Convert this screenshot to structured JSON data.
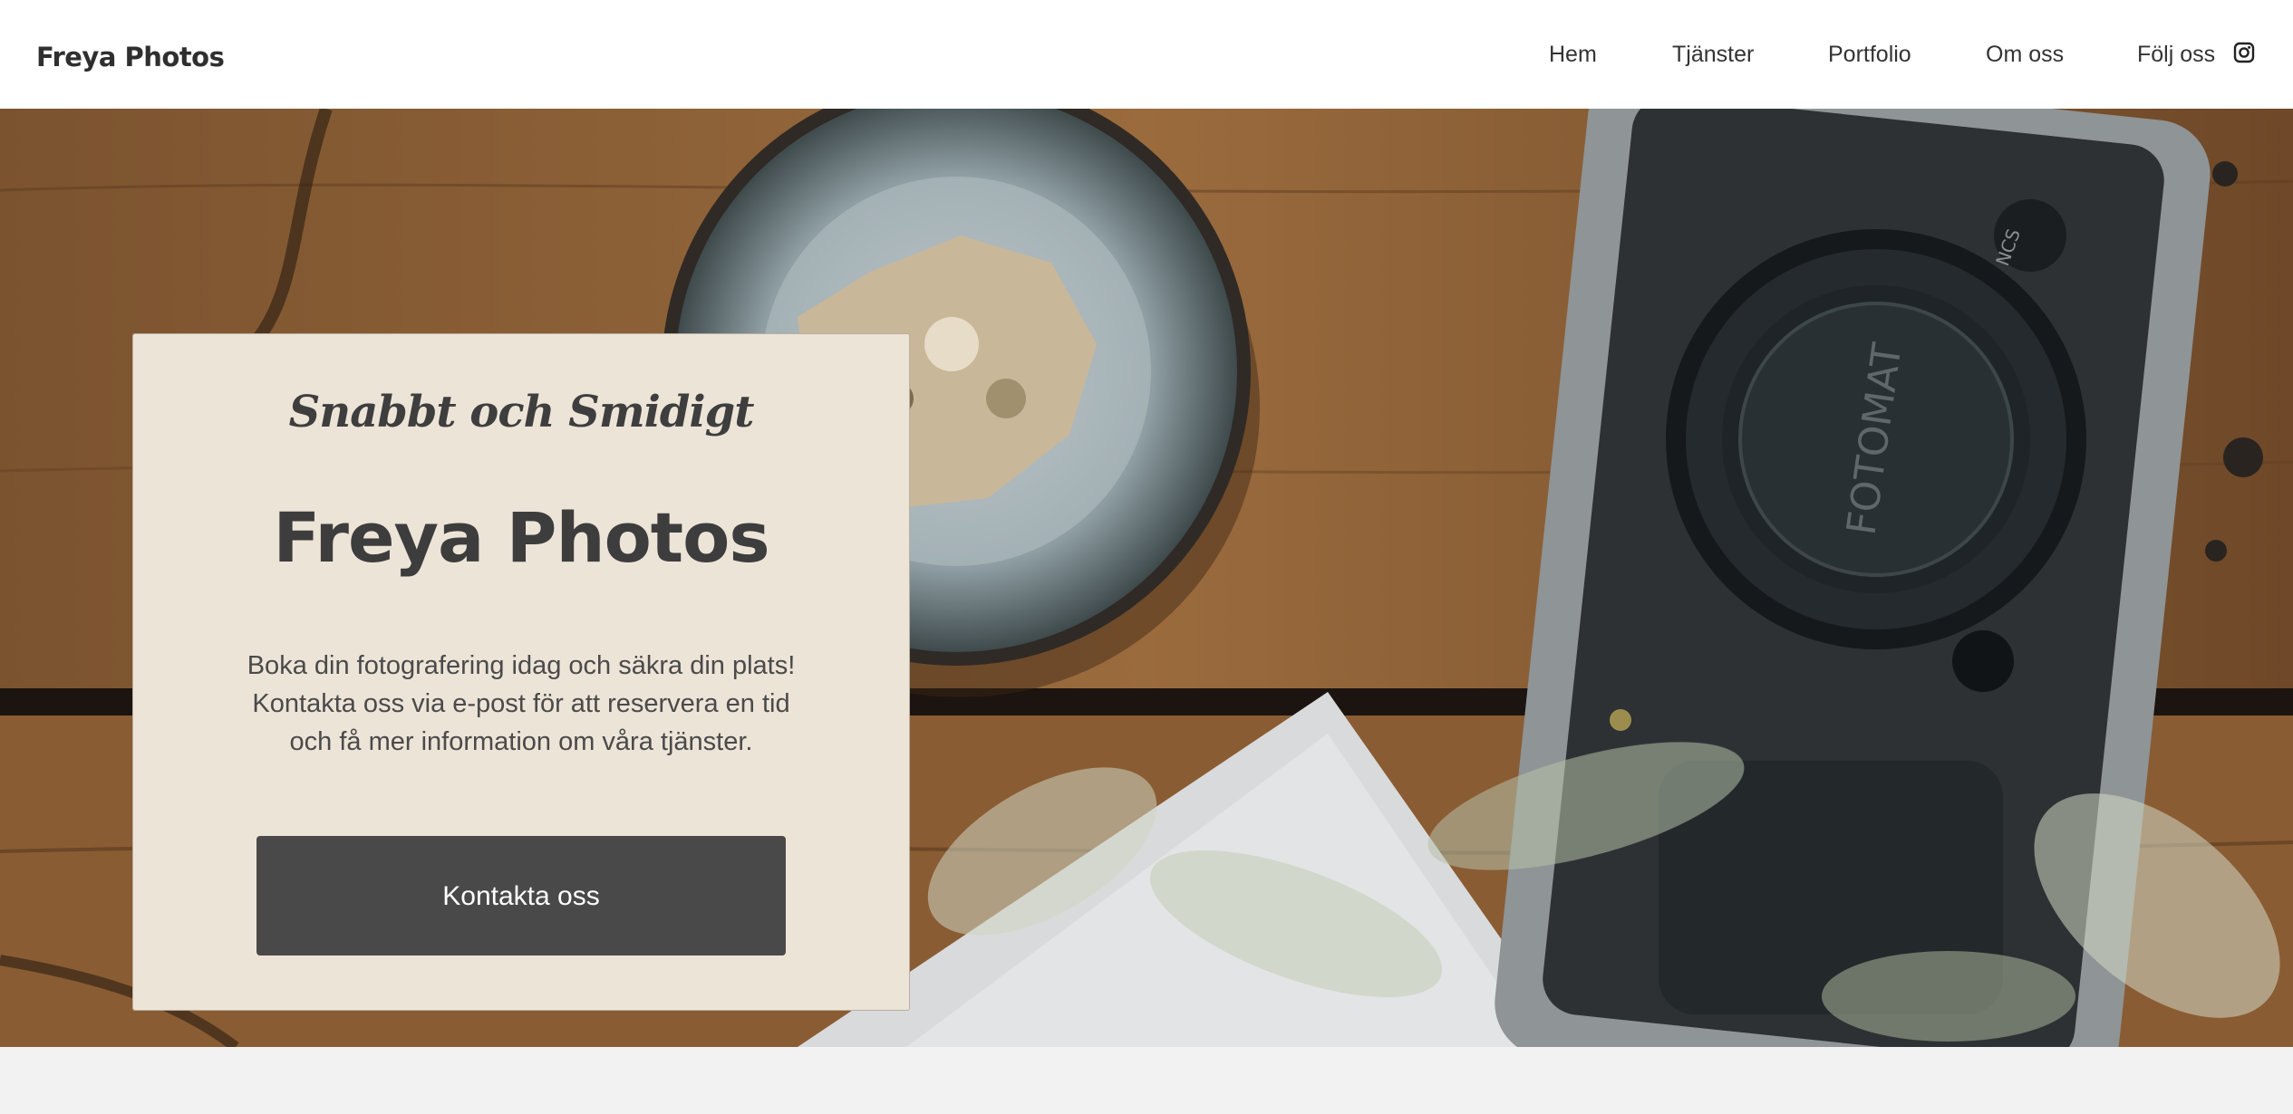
{
  "header": {
    "brand": "Freya Photos",
    "nav": {
      "home": "Hem",
      "services": "Tjänster",
      "portfolio": "Portfolio",
      "about": "Om oss",
      "follow": "Följ oss"
    },
    "social_icon": "instagram-icon"
  },
  "hero": {
    "camera_text": "FOTOMAT",
    "dial_text": "NCS"
  },
  "card": {
    "tagline": "Snabbt och Smidigt",
    "title": "Freya Photos",
    "text": "Boka din fotografering idag och säkra din plats! Kontakta oss via e-post för att reservera en tid och få mer information om våra tjänster.",
    "button": "Kontakta oss"
  },
  "colors": {
    "header_bg": "#ffffff",
    "card_bg": "#ede4d8",
    "button_bg": "#4a4949",
    "footer_bg": "#f2f2f2"
  }
}
